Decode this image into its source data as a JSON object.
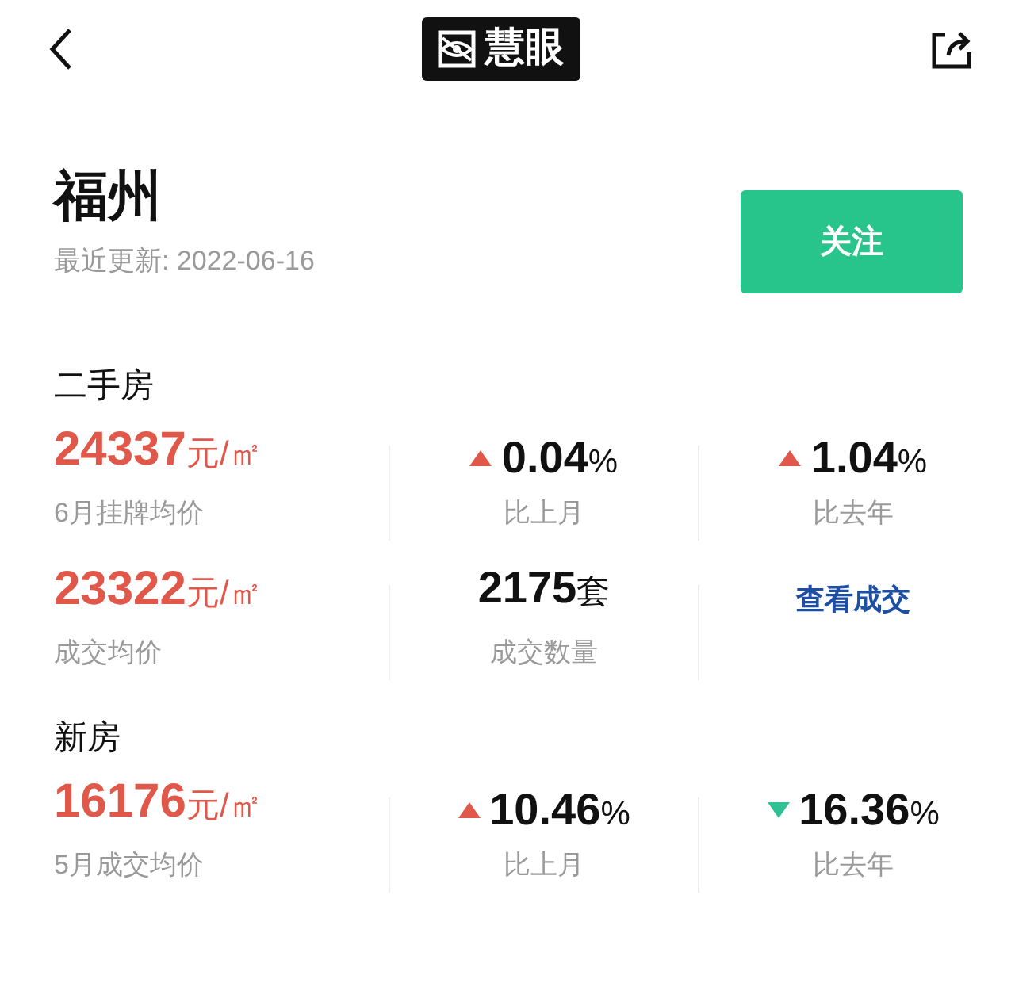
{
  "header": {
    "logo_text": "慧眼"
  },
  "city": {
    "name": "福州",
    "updated": "最近更新: 2022-06-16",
    "follow_button": "关注"
  },
  "sections": [
    {
      "title": "二手房",
      "rows": [
        {
          "cells": [
            {
              "kind": "price",
              "value": "24337",
              "unit": "元/㎡",
              "label": "6月挂牌均价"
            },
            {
              "kind": "change",
              "rising": true,
              "value": "0.04",
              "unit": "%",
              "label": "比上月"
            },
            {
              "kind": "change",
              "rising": true,
              "value": "1.04",
              "unit": "%",
              "label": "比去年"
            }
          ]
        },
        {
          "cells": [
            {
              "kind": "price",
              "value": "23322",
              "unit": "元/㎡",
              "label": "成交均价"
            },
            {
              "kind": "count",
              "value": "2175",
              "unit": "套",
              "label": "成交数量"
            },
            {
              "kind": "link",
              "text": "查看成交"
            }
          ]
        }
      ]
    },
    {
      "title": "新房",
      "rows": [
        {
          "cells": [
            {
              "kind": "price",
              "value": "16176",
              "unit": "元/㎡",
              "label": "5月成交均价"
            },
            {
              "kind": "change",
              "rising": true,
              "value": "10.46",
              "unit": "%",
              "label": "比上月"
            },
            {
              "kind": "change",
              "rising": false,
              "value": "16.36",
              "unit": "%",
              "label": "比去年"
            }
          ]
        }
      ]
    }
  ]
}
